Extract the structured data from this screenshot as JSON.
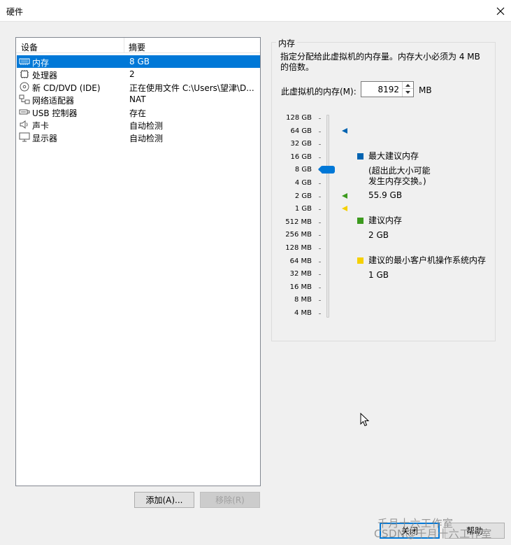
{
  "window": {
    "title": "硬件"
  },
  "device_list": {
    "col_device": "设备",
    "col_summary": "摘要",
    "items": [
      {
        "name": "内存",
        "summary": "8 GB",
        "icon": "memory-icon",
        "selected": true
      },
      {
        "name": "处理器",
        "summary": "2",
        "icon": "cpu-icon"
      },
      {
        "name": "新 CD/DVD (IDE)",
        "summary": "正在使用文件 C:\\Users\\望津\\D...",
        "icon": "disc-icon"
      },
      {
        "name": "网络适配器",
        "summary": "NAT",
        "icon": "network-icon"
      },
      {
        "name": "USB 控制器",
        "summary": "存在",
        "icon": "usb-icon"
      },
      {
        "name": "声卡",
        "summary": "自动检测",
        "icon": "speaker-icon"
      },
      {
        "name": "显示器",
        "summary": "自动检测",
        "icon": "monitor-icon"
      }
    ]
  },
  "buttons": {
    "add": "添加(A)...",
    "remove": "移除(R)",
    "close": "关闭",
    "help": "帮助"
  },
  "memory": {
    "group_title": "内存",
    "description": "指定分配给此虚拟机的内存量。内存大小必须为 4 MB 的倍数。",
    "field_label": "此虚拟机的内存(M):",
    "value": "8192",
    "unit": "MB",
    "ticks": [
      "128 GB",
      "64 GB",
      "32 GB",
      "16 GB",
      "8 GB",
      "4 GB",
      "2 GB",
      "1 GB",
      "512 MB",
      "256 MB",
      "128 MB",
      "64 MB",
      "32 MB",
      "16 MB",
      "8 MB",
      "4 MB"
    ],
    "slider_value": "8 GB",
    "legend": {
      "max_title": "最大建议内存",
      "max_note_1": "(超出此大小可能",
      "max_note_2": "发生内存交换。)",
      "max_value": "55.9 GB",
      "rec_title": "建议内存",
      "rec_value": "2 GB",
      "min_title": "建议的最小客户机操作系统内存",
      "min_value": "1 GB"
    },
    "colors": {
      "max": "#0063b1",
      "rec": "#3c9a1e",
      "min": "#f5d000"
    }
  },
  "watermark": {
    "line1": "千月十六工作室",
    "line2": "CSDN@千月十六工作室"
  }
}
